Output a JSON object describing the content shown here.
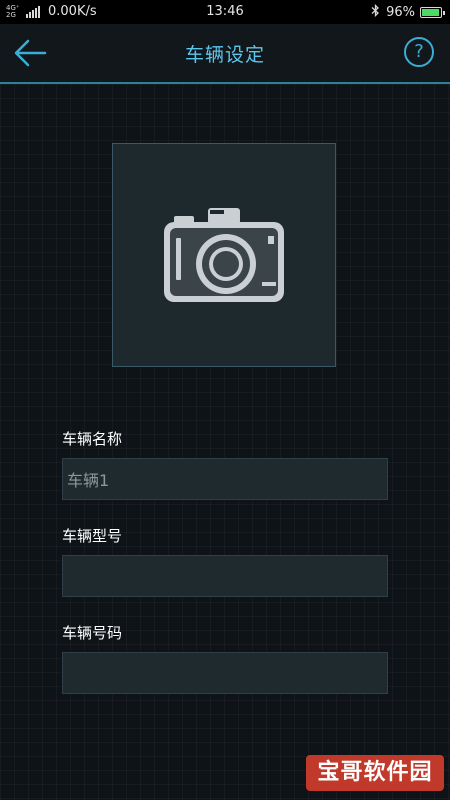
{
  "status_bar": {
    "signal_top": "4G⁺",
    "signal_bottom": "2G",
    "network_speed": "0.00K/s",
    "time": "13:46",
    "battery_percent": "96%",
    "battery_level": 0.96,
    "battery_color": "#4cd964"
  },
  "header": {
    "title": "车辆设定",
    "back_icon": "arrow-left-icon",
    "help_icon": "help-circle-icon",
    "help_glyph": "?",
    "accent_color": "#3aaed6"
  },
  "photo": {
    "icon": "camera-icon"
  },
  "form": {
    "vehicle_name": {
      "label": "车辆名称",
      "value": "车辆1"
    },
    "vehicle_model": {
      "label": "车辆型号",
      "value": ""
    },
    "vehicle_number": {
      "label": "车辆号码",
      "value": ""
    }
  },
  "watermark": {
    "text": "宝哥软件园"
  }
}
